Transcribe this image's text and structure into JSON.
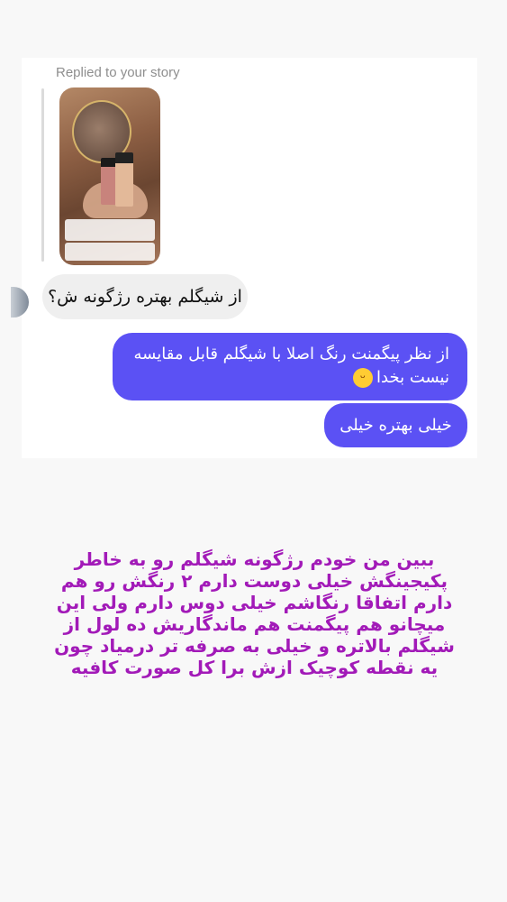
{
  "thread": {
    "replied_label": "Replied to your story",
    "story_reply": "از شیگلم بهتره رژگونه ش؟",
    "messages": [
      {
        "text": "از نظر پیگمنت رنگ اصلا با شیگلم قابل مقایسه نیست بخدا",
        "emoji": "grinning-face-emoji"
      },
      {
        "text": "خیلی بهتره خیلی"
      }
    ]
  },
  "caption": {
    "lines": "ببین من خودم رژگونه شیگلم رو به خاطر\nپکیجینگش خیلی دوست دارم ۲ رنگش رو هم\nدارم اتفاقا رنگاشم خیلی دوس دارم ولی این\nمیچانو هم پیگمنت هم ماندگاریش ده لول از\nشیگلم بالاتره و خیلی به صرفه تر درمیاد چون\nیه نقطه کوچیک ازش برا کل صورت کافیه",
    "color": "#a21ab8"
  },
  "colors": {
    "outgoing_bubble": "#5b51f4",
    "incoming_bubble": "#efefef",
    "background": "#f8f8f8"
  }
}
